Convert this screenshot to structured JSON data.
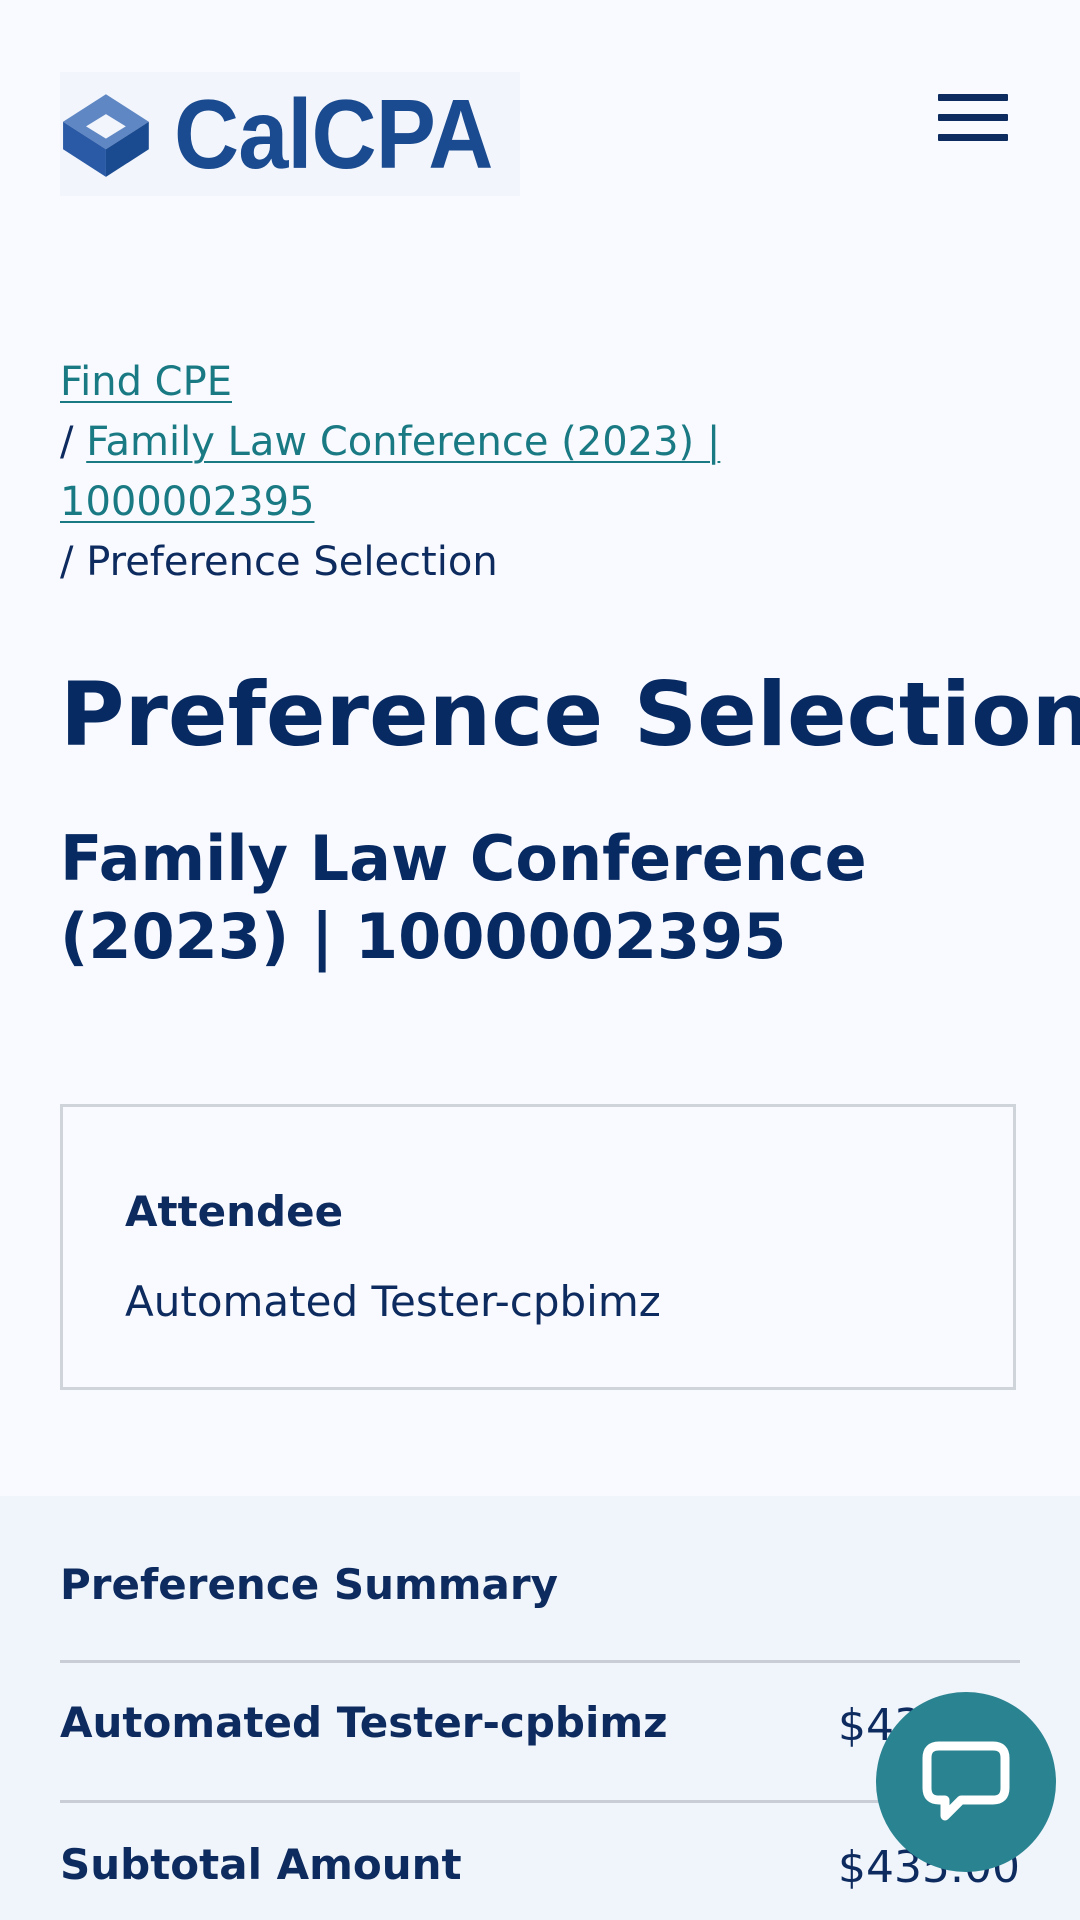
{
  "header": {
    "logo_text": "CalCPA",
    "menu_icon": "hamburger-menu-icon"
  },
  "breadcrumb": {
    "items": [
      {
        "label": "Find CPE"
      },
      {
        "label": "Family Law Conference (2023) | 1000002395"
      },
      {
        "label": "Preference Selection"
      }
    ],
    "separator": "/"
  },
  "main": {
    "page_title": "Preference Selection",
    "event_title": "Family Law Conference (2023) | 1000002395"
  },
  "attendee_card": {
    "label": "Attendee",
    "name": "Automated Tester-cpbimz"
  },
  "summary": {
    "heading": "Preference Summary",
    "rows": [
      {
        "label": "Automated Tester-cpbimz",
        "value": "$435.00"
      },
      {
        "label": "Subtotal Amount",
        "value": "$435.00"
      }
    ]
  },
  "chat": {
    "icon": "chat-bubble-icon"
  },
  "colors": {
    "navy": "#0d2b5e",
    "link_teal": "#1a7a84",
    "logo_blue": "#1a4a8f",
    "chat_teal": "#2a8390",
    "summary_bg": "#f0f4fb"
  }
}
